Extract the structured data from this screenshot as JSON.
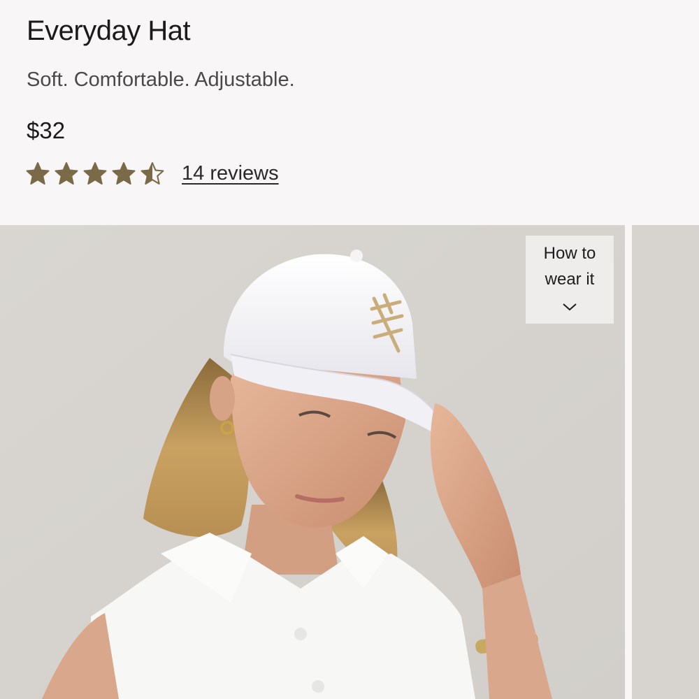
{
  "product": {
    "title": "Everyday Hat",
    "subtitle": "Soft. Comfortable. Adjustable.",
    "price": "$32",
    "rating": 4.5,
    "rating_max": 5,
    "reviews_label": "14 reviews",
    "star_color": "#7a6a48"
  },
  "gallery": {
    "how_to_line1": "How to",
    "how_to_line2": "wear it",
    "how_to_icon": "chevron-down-icon",
    "main_image": "woman-in-white-cap-photo",
    "next_image": "next-slide-photo-peek"
  }
}
